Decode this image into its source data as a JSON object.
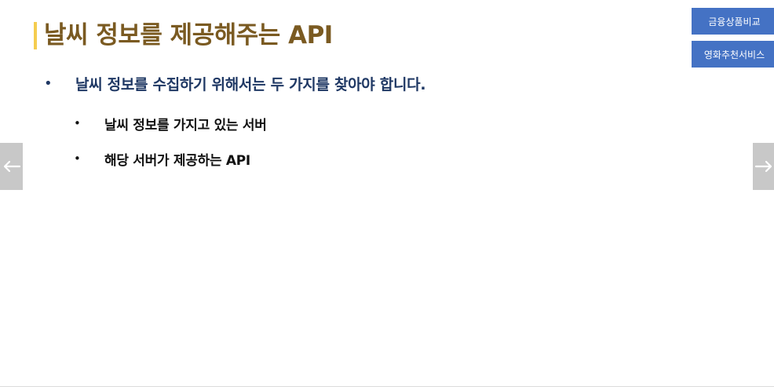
{
  "slide": {
    "title": "날씨 정보를 제공해주는 API",
    "bullet_main": {
      "marker": "•",
      "text": "날씨 정보를 수집하기 위해서는 두 가지를 찾아야 합니다."
    },
    "bullets_sub": [
      {
        "marker": "•",
        "text": "날씨 정보를 가지고 있는 서버"
      },
      {
        "marker": "•",
        "text": "해당 서버가 제공하는 API"
      }
    ]
  },
  "side_buttons": {
    "finance_label": "금융상품비교",
    "movie_label": "영화추천서비스"
  },
  "nav": {
    "prev_icon": "arrow-left-icon",
    "next_icon": "arrow-right-icon"
  },
  "colors": {
    "title": "#7a5a21",
    "title_accent": "#f5cd4f",
    "main_bullet": "#1f3864",
    "button_bg": "#4472c4",
    "nav_bg": "#c8c8c8"
  }
}
